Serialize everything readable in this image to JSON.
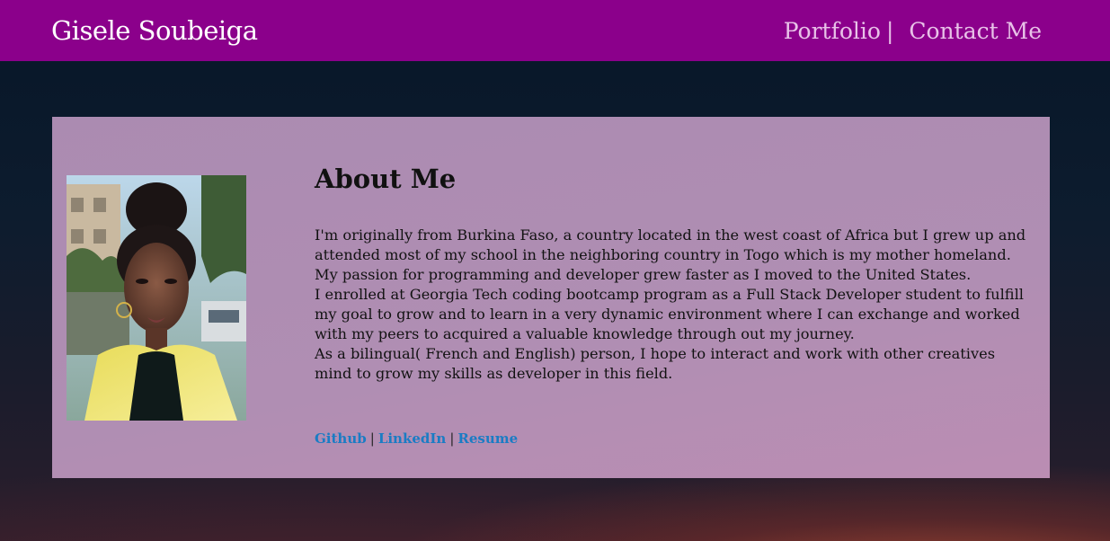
{
  "nav": {
    "brand": "Gisele Soubeiga",
    "links": [
      {
        "label": "Portfolio"
      },
      {
        "label": "Contact Me"
      }
    ],
    "separator": "|"
  },
  "about": {
    "heading": "About Me",
    "paragraphs": [
      "I'm originally from Burkina Faso, a country located in the west coast of Africa but I grew up and attended most of my school in the neighboring country in Togo which is my mother homeland.",
      "My passion for programming and developer grew faster as I moved to the United States.",
      "I enrolled at Georgia Tech coding bootcamp program as a Full Stack Developer student to fulfill my goal to grow and to learn in a very dynamic environment where I can exchange and worked with my peers to acquired a valuable knowledge through out my journey.",
      "As a bilingual( French and English) person, I hope to interact and work with other creatives mind to grow my skills as developer in this field."
    ]
  },
  "profile_links": {
    "github": "Github",
    "linkedin": "LinkedIn",
    "resume": "Resume",
    "separator": "|"
  },
  "colors": {
    "navbar": "#8b008b",
    "card": "#b08eb3",
    "link": "#1a7cc4"
  }
}
